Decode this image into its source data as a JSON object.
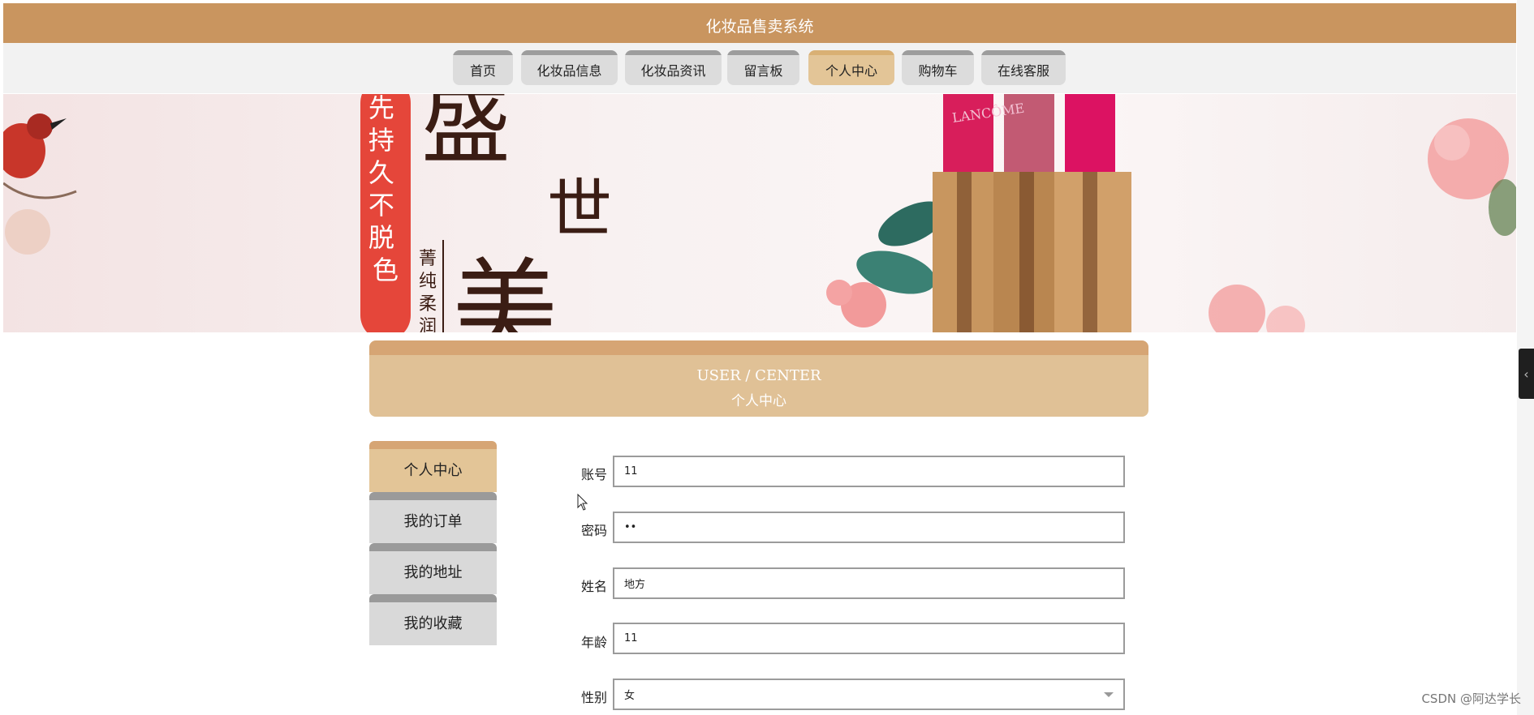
{
  "header": {
    "title": "化妆品售卖系统",
    "color": "#c9955f"
  },
  "nav": {
    "tabs": [
      {
        "label": "首页",
        "active": false
      },
      {
        "label": "化妆品信息",
        "active": false
      },
      {
        "label": "化妆品资讯",
        "active": false
      },
      {
        "label": "留言板",
        "active": false
      },
      {
        "label": "个人中心",
        "active": true
      },
      {
        "label": "购物车",
        "active": false
      },
      {
        "label": "在线客服",
        "active": false
      }
    ]
  },
  "banner": {
    "red_badge_text": "先持久不脱色",
    "big_chars": [
      "盛",
      "世",
      "美"
    ],
    "small_text": "菁纯柔润",
    "lipstick_brand": "LANCÔME"
  },
  "center": {
    "title_en": "USER / CENTER",
    "title_cn": "个人中心"
  },
  "sidebar": {
    "items": [
      {
        "label": "个人中心",
        "active": true
      },
      {
        "label": "我的订单",
        "active": false
      },
      {
        "label": "我的地址",
        "active": false
      },
      {
        "label": "我的收藏",
        "active": false
      }
    ]
  },
  "form": {
    "account": {
      "label": "账号",
      "value": "11"
    },
    "password": {
      "label": "密码",
      "value": "••"
    },
    "name": {
      "label": "姓名",
      "value": "地方"
    },
    "age": {
      "label": "年龄",
      "value": "11"
    },
    "gender": {
      "label": "性别",
      "value": "女"
    }
  },
  "watermark": "CSDN @阿达学长"
}
